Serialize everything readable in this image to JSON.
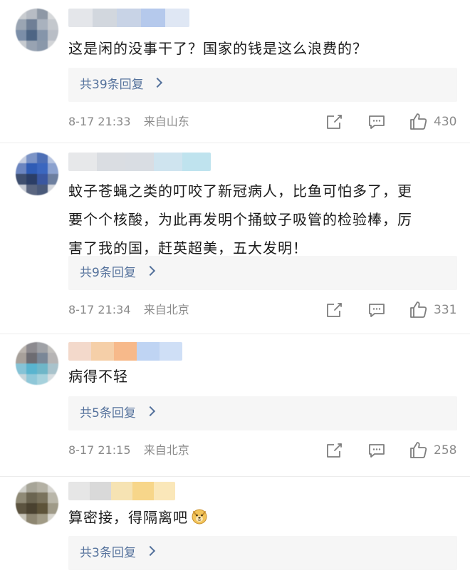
{
  "comments": [
    {
      "text_lines": [
        "这是闲的没事干了？国家的钱是这么浪费的？"
      ],
      "reply_label": "共39条回复",
      "time": "8-17 21:33",
      "location": "来自山东",
      "likes": "430",
      "avatar_colors": [
        "#c9ccd0",
        "#b7bcc4",
        "#8e98a6",
        "#d6d8da",
        "#9aa5b3",
        "#6f7f96",
        "#a9b2be",
        "#c4c8cd",
        "#7b8ea8",
        "#4d6584",
        "#8595aa",
        "#b9bec6",
        "#c7cbd0",
        "#98a3b2",
        "#8a98aa",
        "#d2d4d7"
      ],
      "name_colors": [
        "#e4e6ea",
        "#d2d7de",
        "#c8d3e6",
        "#b5c9ec",
        "#dfe7f4"
      ]
    },
    {
      "text_lines": [
        "蚊子苍蝇之类的叮咬了新冠病人，比鱼可怕多了，更",
        "要个个核酸，为此再发明个捅蚊子吸管的检验棒，厉",
        "害了我的国，赶英超美，五大发明！"
      ],
      "reply_label": "共9条回复",
      "time": "8-17 21:34",
      "location": "来自北京",
      "likes": "331",
      "avatar_colors": [
        "#c5cde0",
        "#7c94c6",
        "#4d6fb6",
        "#b6c4e0",
        "#6c86c0",
        "#2f5cb5",
        "#3b67bf",
        "#8ca2cf",
        "#3f4f6f",
        "#2b3e66",
        "#3a57a0",
        "#6d7f9f",
        "#c4c9d2",
        "#5a6680",
        "#4a5a7a",
        "#d3d6dc"
      ],
      "name_colors": [
        "#e7e8ea",
        "#dadde2",
        "#d9dde3",
        "#cfe4ef",
        "#bfe3ee"
      ]
    },
    {
      "text_lines": [
        "病得不轻"
      ],
      "reply_label": "共5条回复",
      "time": "8-17 21:15",
      "location": "来自北京",
      "likes": "258",
      "avatar_colors": [
        "#b9b3ad",
        "#8c8a8f",
        "#9fa1a6",
        "#c2c0bd",
        "#a7a09a",
        "#6d6c72",
        "#7a8797",
        "#b6b4b4",
        "#86c3d6",
        "#59b4cf",
        "#6fb6c8",
        "#a9c3cc",
        "#c6d5da",
        "#8fc7d8",
        "#a6d1dc",
        "#d6dde0"
      ],
      "name_colors": [
        "#f3d9cb",
        "#f5cfa8",
        "#f7b98a",
        "#bfd4f3",
        "#cfdff6"
      ]
    },
    {
      "text_lines": [
        "算密接，得隔离吧"
      ],
      "reply_label": "共3条回复",
      "time": "",
      "location": "",
      "likes": "",
      "avatar_colors": [
        "#cfcfc9",
        "#a7a598",
        "#b4b1a4",
        "#d6d5d0",
        "#8f8a76",
        "#6b6551",
        "#7a735d",
        "#b9b6a9",
        "#5c5440",
        "#4a4230",
        "#5d5339",
        "#9f9a88",
        "#c7c4b8",
        "#8d8671",
        "#a19b86",
        "#d8d6cf"
      ],
      "name_colors": [
        "#e6e6e6",
        "#d9d9d9",
        "#f6e3b3",
        "#f7d68a",
        "#fae7b9"
      ]
    }
  ],
  "icons": {
    "share": "share-icon",
    "comment": "comment-icon",
    "like": "thumbs-up-icon",
    "emoji": "doge-emoji-icon"
  },
  "colors": {
    "link": "#55729c",
    "meta": "#8a8a8a",
    "reply_bg": "#f6f6f6"
  }
}
